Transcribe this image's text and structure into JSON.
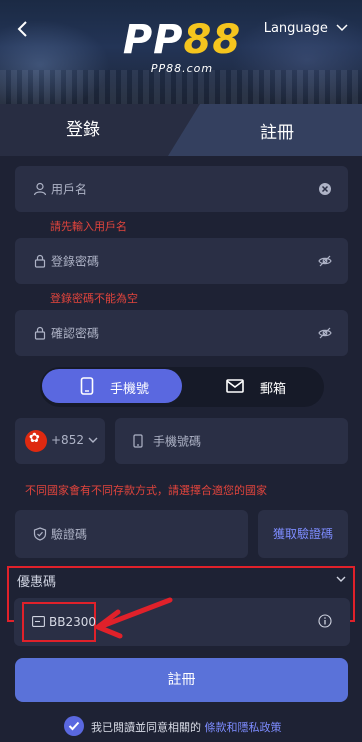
{
  "header": {
    "logo_main_a": "PP",
    "logo_main_b": "88",
    "logo_sub": "PP88.com",
    "language_label": "Language"
  },
  "tabs": {
    "login": "登錄",
    "register": "註冊"
  },
  "form": {
    "username_placeholder": "用戶名",
    "username_error": "請先輸入用戶名",
    "password_placeholder": "登錄密碼",
    "password_error": "登錄密碼不能為空",
    "confirm_placeholder": "確認密碼",
    "toggle_phone": "手機號",
    "toggle_email": "郵箱",
    "country_code": "+852",
    "phone_placeholder": "手機號碼",
    "country_note": "不同國家會有不同存款方式，請選擇合適您的國家",
    "code_placeholder": "驗證碼",
    "get_code": "獲取驗證碼"
  },
  "promo": {
    "title": "優惠碼",
    "code": "BB2300"
  },
  "submit_label": "註冊",
  "agreement": {
    "prefix": "我已閱讀並同意相關的 ",
    "link": "條款和隱私政策"
  },
  "colors": {
    "accent": "#5a68e0",
    "error": "#e0443c",
    "highlight": "#e0212a",
    "logo_yellow": "#f5c51e"
  },
  "icons": [
    "back-icon",
    "user-icon",
    "clear-icon",
    "lock-icon",
    "eye-off-icon",
    "phone-icon",
    "mail-icon",
    "hk-flag-icon",
    "chevron-down-icon",
    "shield-check-icon",
    "ticket-icon",
    "info-icon",
    "check-icon",
    "red-arrow"
  ]
}
